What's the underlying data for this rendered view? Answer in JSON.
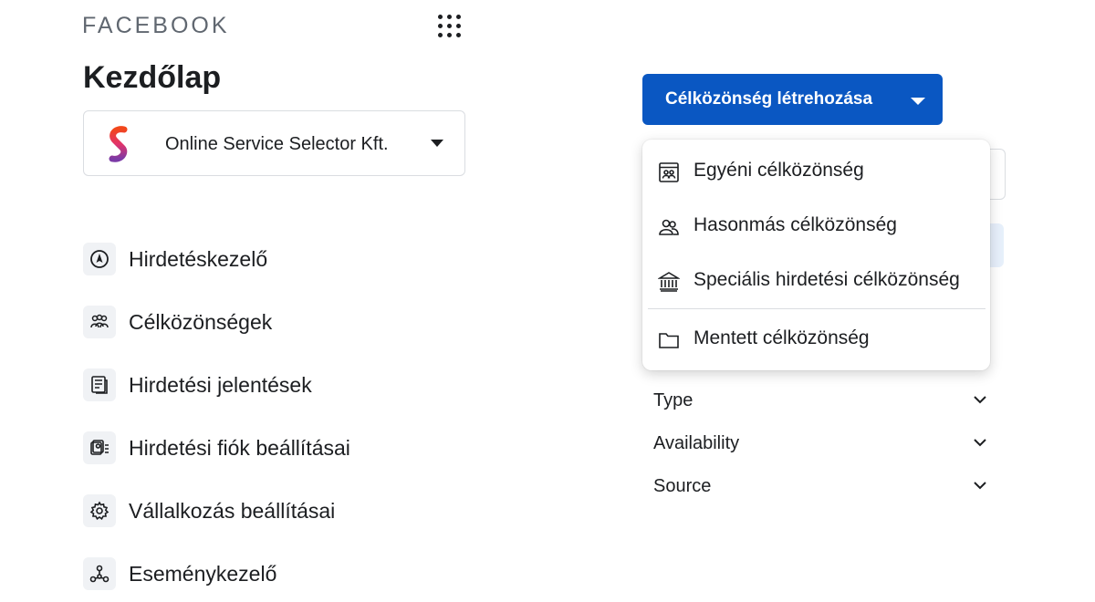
{
  "brand": "FACEBOOK",
  "page_title": "Kezdőlap",
  "account": {
    "name": "Online Service Selector Kft."
  },
  "nav": [
    {
      "label": "Hirdetéskezelő",
      "icon": "compass-icon"
    },
    {
      "label": "Célközönségek",
      "icon": "people-icon"
    },
    {
      "label": "Hirdetési jelentések",
      "icon": "report-icon"
    },
    {
      "label": "Hirdetési fiók beállításai",
      "icon": "account-settings-icon"
    },
    {
      "label": "Vállalkozás beállításai",
      "icon": "gear-icon"
    },
    {
      "label": "Eseménykezelő",
      "icon": "events-icon"
    }
  ],
  "create_button": {
    "label": "Célközönség létrehozása"
  },
  "dropdown": {
    "items": [
      {
        "label": "Egyéni célközönség",
        "icon": "custom-audience-icon"
      },
      {
        "label": "Hasonmás célközönség",
        "icon": "lookalike-audience-icon"
      },
      {
        "label": "Speciális hirdetési célközönség",
        "icon": "institution-icon"
      },
      {
        "label": "Mentett célközönség",
        "icon": "folder-icon"
      }
    ]
  },
  "filters": [
    {
      "label": "Type"
    },
    {
      "label": "Availability"
    },
    {
      "label": "Source"
    }
  ],
  "colors": {
    "primary": "#0a57c2",
    "text": "#1c1e21",
    "muted": "#606770",
    "icon_bg": "#f0f2f5"
  }
}
